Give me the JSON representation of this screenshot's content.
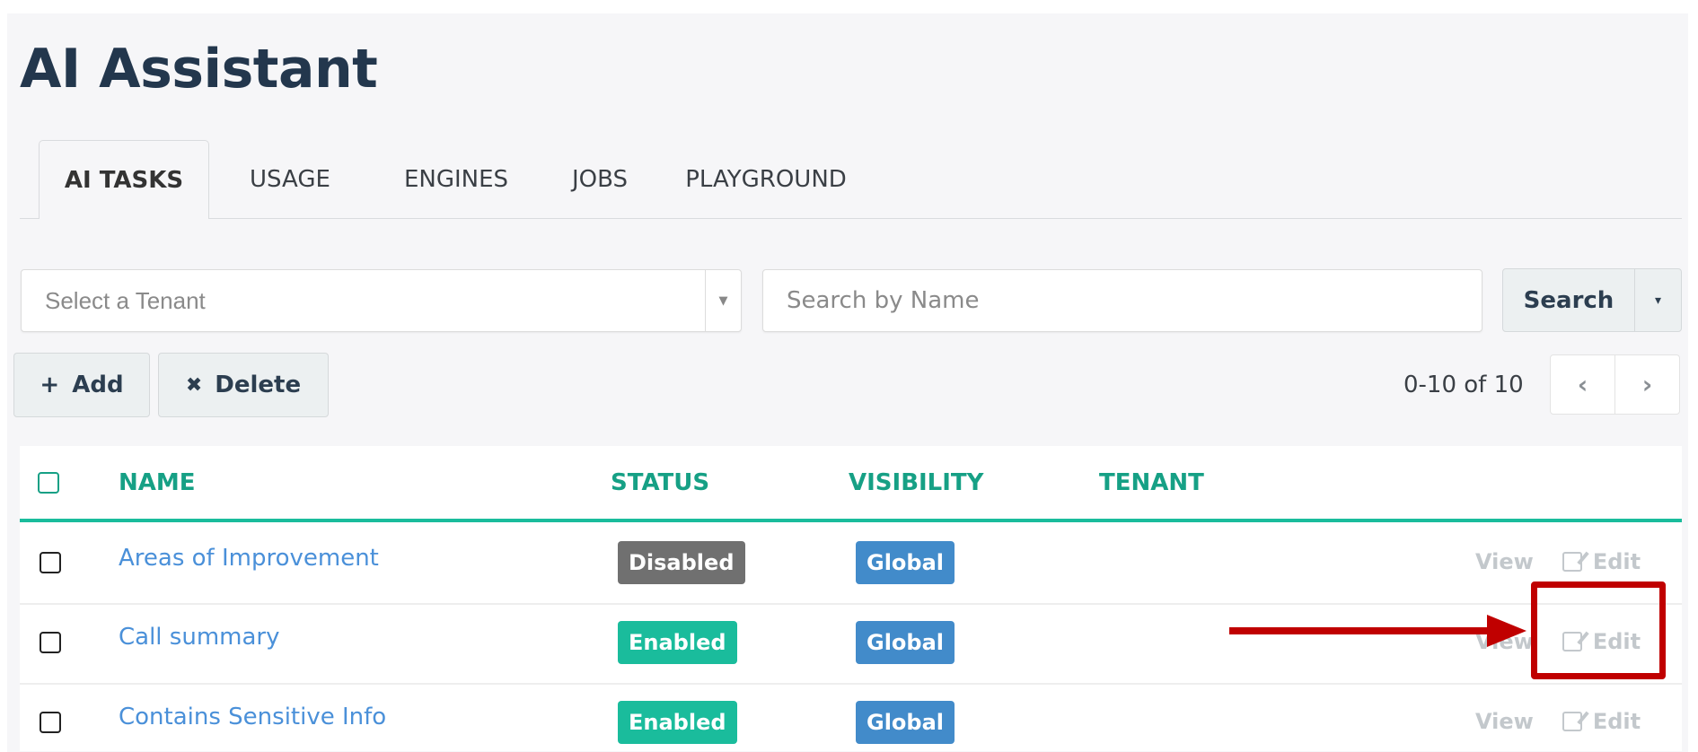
{
  "page_title": "AI Assistant",
  "tabs": [
    {
      "label": "AI TASKS",
      "active": true
    },
    {
      "label": "USAGE",
      "active": false
    },
    {
      "label": "ENGINES",
      "active": false
    },
    {
      "label": "JOBS",
      "active": false
    },
    {
      "label": "PLAYGROUND",
      "active": false
    }
  ],
  "filters": {
    "tenant_select": {
      "placeholder": "Select a Tenant",
      "arrow_icon": "▼"
    },
    "search_input": {
      "placeholder": "Search by Name",
      "value": ""
    },
    "search_button": "Search",
    "search_caret_icon": "▾"
  },
  "toolbar": {
    "add": {
      "icon": "+",
      "label": "Add"
    },
    "delete": {
      "icon": "✖",
      "label": "Delete"
    }
  },
  "pagination": {
    "range_text": "0-10 of 10",
    "prev_icon": "‹",
    "next_icon": "›"
  },
  "table": {
    "columns": [
      "NAME",
      "STATUS",
      "VISIBILITY",
      "TENANT"
    ],
    "rows": [
      {
        "name": "Areas of Improvement",
        "status": "Disabled",
        "visibility": "Global",
        "tenant": "",
        "view": "View",
        "edit": "Edit"
      },
      {
        "name": "Call summary",
        "status": "Enabled",
        "visibility": "Global",
        "tenant": "",
        "view": "View",
        "edit": "Edit"
      },
      {
        "name": "Contains Sensitive Info",
        "status": "Enabled",
        "visibility": "Global",
        "tenant": "",
        "view": "View",
        "edit": "Edit"
      }
    ]
  },
  "colors": {
    "accent": "#1abc9c",
    "header_text": "#16a085",
    "link": "#4a90d9",
    "status_enabled": "#1abc9c",
    "status_disabled": "#707070",
    "visibility_global": "#428bca",
    "annotation": "#c00000"
  }
}
